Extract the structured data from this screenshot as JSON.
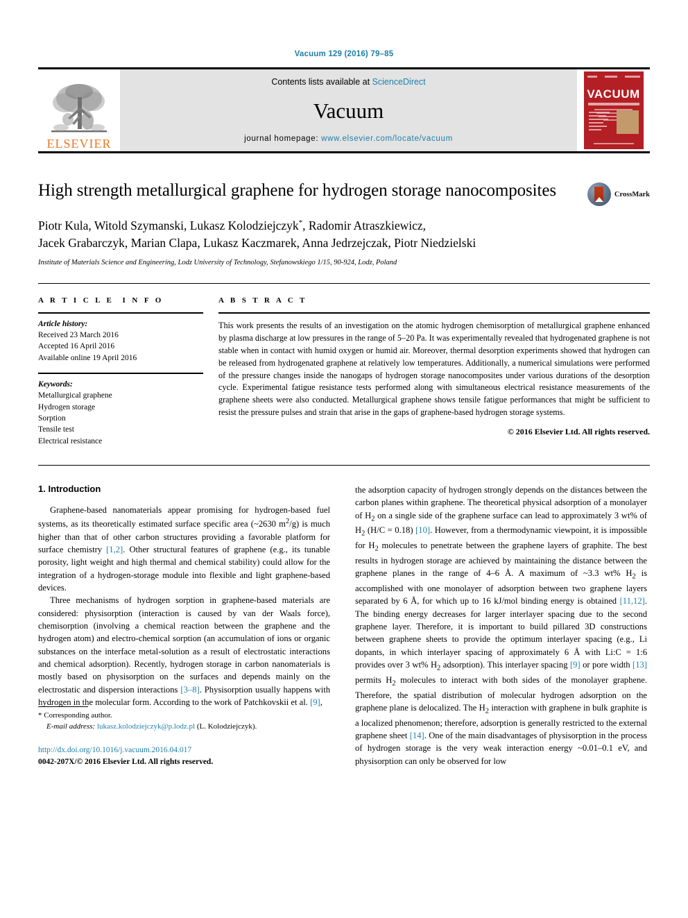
{
  "running_head": "Vacuum 129 (2016) 79–85",
  "masthead": {
    "publisher_logo_label": "ELSEVIER",
    "contents_prefix": "Contents lists available at",
    "contents_link": "ScienceDirect",
    "journal_name": "Vacuum",
    "homepage_prefix": "journal homepage:",
    "homepage_url": "www.elsevier.com/locate/vacuum",
    "cover_title": "VACUUM"
  },
  "article": {
    "title": "High strength metallurgical graphene for hydrogen storage nanocomposites",
    "crossmark_label": "CrossMark",
    "authors": "Piotr Kula, Witold Szymanski, Lukasz Kolodziejczyk*, Radomir Atraszkiewicz, Jacek Grabarczyk, Marian Clapa, Lukasz Kaczmarek, Anna Jedrzejczak, Piotr Niedzielski",
    "authors_line1_pre": "Piotr Kula, Witold Szymanski, Lukasz Kolodziejczyk",
    "authors_line1_post": ", Radomir Atraszkiewicz,",
    "authors_marker": "*",
    "authors_line2": "Jacek Grabarczyk, Marian Clapa, Lukasz Kaczmarek, Anna Jedrzejczak, Piotr Niedzielski",
    "affiliation": "Institute of Materials Science and Engineering, Lodz University of Technology, Stefanowskiego 1/15, 90-924, Lodz, Poland"
  },
  "article_info": {
    "heading": "ARTICLE INFO",
    "history_label": "Article history:",
    "history": [
      "Received 23 March 2016",
      "Accepted 16 April 2016",
      "Available online 19 April 2016"
    ],
    "keywords_label": "Keywords:",
    "keywords": [
      "Metallurgical graphene",
      "Hydrogen storage",
      "Sorption",
      "Tensile test",
      "Electrical resistance"
    ]
  },
  "abstract": {
    "heading": "ABSTRACT",
    "text": "This work presents the results of an investigation on the atomic hydrogen chemisorption of metallurgical graphene enhanced by plasma discharge at low pressures in the range of 5–20 Pa. It was experimentally revealed that hydrogenated graphene is not stable when in contact with humid oxygen or humid air. Moreover, thermal desorption experiments showed that hydrogen can be released from hydrogenated graphene at relatively low temperatures. Additionally, a numerical simulations were performed of the pressure changes inside the nanogaps of hydrogen storage nanocomposites under various durations of the desorption cycle. Experimental fatigue resistance tests performed along with simultaneous electrical resistance measurements of the graphene sheets were also conducted. Metallurgical graphene shows tensile fatigue performances that might be sufficient to resist the pressure pulses and strain that arise in the gaps of graphene-based hydrogen storage systems.",
    "copyright": "© 2016 Elsevier Ltd. All rights reserved."
  },
  "body": {
    "section_heading": "1. Introduction",
    "left_paragraph_1_a": "Graphene-based nanomaterials appear promising for hydrogen-based fuel systems, as its theoretically estimated surface specific area (~2630 m",
    "left_paragraph_1_sup": "2",
    "left_paragraph_1_b": "/g) is much higher than that of other carbon structures providing a favorable platform for surface chemistry ",
    "left_paragraph_1_ref": "[1,2]",
    "left_paragraph_1_c": ". Other structural features of graphene (e.g., its tunable porosity, light weight and high thermal and chemical stability) could allow for the integration of a hydrogen-storage module into flexible and light graphene-based devices.",
    "left_paragraph_2_a": "Three mechanisms of hydrogen sorption in graphene-based materials are considered: physisorption (interaction is caused by van der Waals force), chemisorption (involving a chemical reaction between the graphene and the hydrogen atom) and electro-chemical sorption (an accumulation of ions or organic substances on the interface metal-solution as a result of electrostatic interactions and chemical adsorption). Recently, hydrogen storage in carbon nanomaterials is mostly based on physisorption on the surfaces and depends mainly on the electrostatic and dispersion interactions ",
    "left_paragraph_2_ref1": "[3–8]",
    "left_paragraph_2_b": ". Physisorption usually happens with hydrogen in the molecular form. According to the work of Patchkovskii et al. ",
    "left_paragraph_2_ref2": "[9]",
    "left_paragraph_2_c": ",",
    "right_paragraph_a": "the adsorption capacity of hydrogen strongly depends on the distances between the carbon planes within graphene. The theoretical physical adsorption of a monolayer of H",
    "right_sub_1": "2",
    "right_paragraph_b": " on a single side of the graphene surface can lead to approximately 3 wt% of H",
    "right_sub_2": "2",
    "right_paragraph_c": " (H/C = 0.18) ",
    "right_ref_10": "[10]",
    "right_paragraph_d": ". However, from a thermodynamic viewpoint, it is impossible for H",
    "right_sub_3": "2",
    "right_paragraph_e": " molecules to penetrate between the graphene layers of graphite. The best results in hydrogen storage are achieved by maintaining the distance between the graphene planes in the range of 4–6 Å. A maximum of ~3.3 wt% H",
    "right_sub_4": "2",
    "right_paragraph_f": " is accomplished with one monolayer of adsorption between two graphene layers separated by 6 Å, for which up to 16 kJ/mol binding energy is obtained ",
    "right_ref_1112": "[11,12]",
    "right_paragraph_g": ". The binding energy decreases for larger interlayer spacing due to the second graphene layer. Therefore, it is important to build pillared 3D constructions between graphene sheets to provide the optimum interlayer spacing (e.g., Li dopants, in which interlayer spacing of approximately 6 Å with Li:C = 1:6 provides over 3 wt% H",
    "right_sub_5": "2",
    "right_paragraph_h": " adsorption). This interlayer spacing ",
    "right_ref_9": "[9]",
    "right_paragraph_i": " or pore width ",
    "right_ref_13": "[13]",
    "right_paragraph_j": " permits H",
    "right_sub_6": "2",
    "right_paragraph_k": " molecules to interact with both sides of the monolayer graphene. Therefore, the spatial distribution of molecular hydrogen adsorption on the graphene plane is delocalized. The H",
    "right_sub_7": "2",
    "right_paragraph_l": " interaction with graphene in bulk graphite is a localized phenomenon; therefore, adsorption is generally restricted to the external graphene sheet ",
    "right_ref_14": "[14]",
    "right_paragraph_m": ". One of the main disadvantages of physisorption in the process of hydrogen storage is the very weak interaction energy ~0.01–0.1 eV, and physisorption can only be observed for low"
  },
  "footer": {
    "corresponding_marker": "*",
    "corresponding_label": "Corresponding author.",
    "email_label": "E-mail address:",
    "email": "lukasz.kolodziejczyk@p.lodz.pl",
    "email_owner": "(L. Kolodziejczyk).",
    "doi": "http://dx.doi.org/10.1016/j.vacuum.2016.04.017",
    "issn_line": "0042-207X/© 2016 Elsevier Ltd. All rights reserved."
  },
  "colors": {
    "link_blue": "#1d7fa8",
    "elsevier_orange": "#e87722",
    "cover_red": "#b31f24",
    "masthead_grey": "#e3e3e3"
  }
}
